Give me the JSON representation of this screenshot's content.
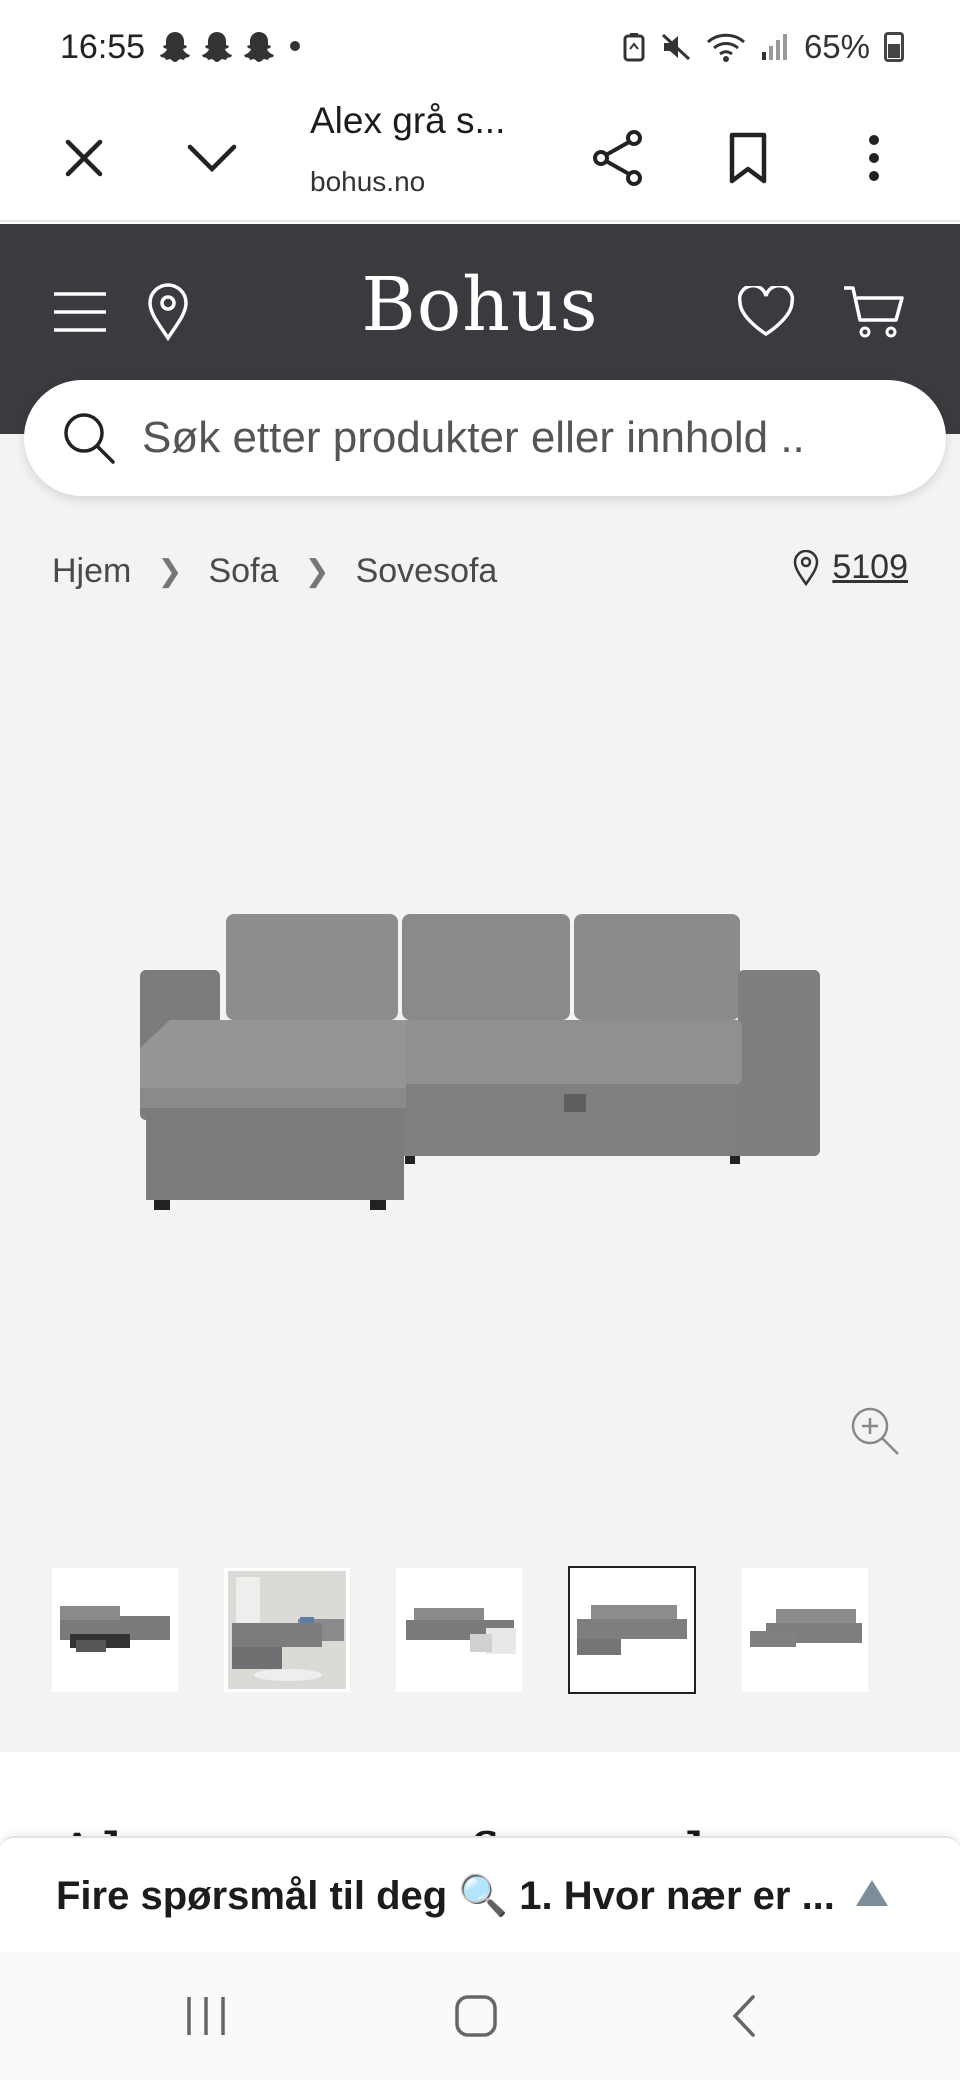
{
  "status_bar": {
    "time": "16:55",
    "battery": "65%",
    "icons": [
      "snapchat-icon",
      "snapchat-icon",
      "snapchat-icon",
      "dot",
      "battery-saver-icon",
      "mute-icon",
      "wifi-icon",
      "signal-icon",
      "battery-icon"
    ]
  },
  "tab_toolbar": {
    "title": "Alex grå s...",
    "domain": "bohus.no",
    "icons": [
      "close-icon",
      "chevron-down-icon",
      "share-icon",
      "bookmark-icon",
      "more-vertical-icon"
    ]
  },
  "header": {
    "logo": "Bohus",
    "icons": [
      "menu-icon",
      "location-pin-icon",
      "heart-icon",
      "cart-icon"
    ],
    "background": "#3a3a3f"
  },
  "search": {
    "placeholder": "Søk etter produkter eller innhold .."
  },
  "breadcrumb": {
    "items": [
      "Hjem",
      "Sofa",
      "Sovesofa"
    ],
    "store_number": "5109"
  },
  "gallery": {
    "thumbnail_count": 5,
    "active_index": 3,
    "background": "#f4f3f1"
  },
  "title_peek": "Alex sovesofa med sjeselong",
  "bottom_bar": {
    "text": "Fire spørsmål til deg 🔍 1. Hvor nær er ..."
  },
  "nav_bar": {
    "icons": [
      "recent-apps-icon",
      "home-icon",
      "back-icon"
    ]
  }
}
